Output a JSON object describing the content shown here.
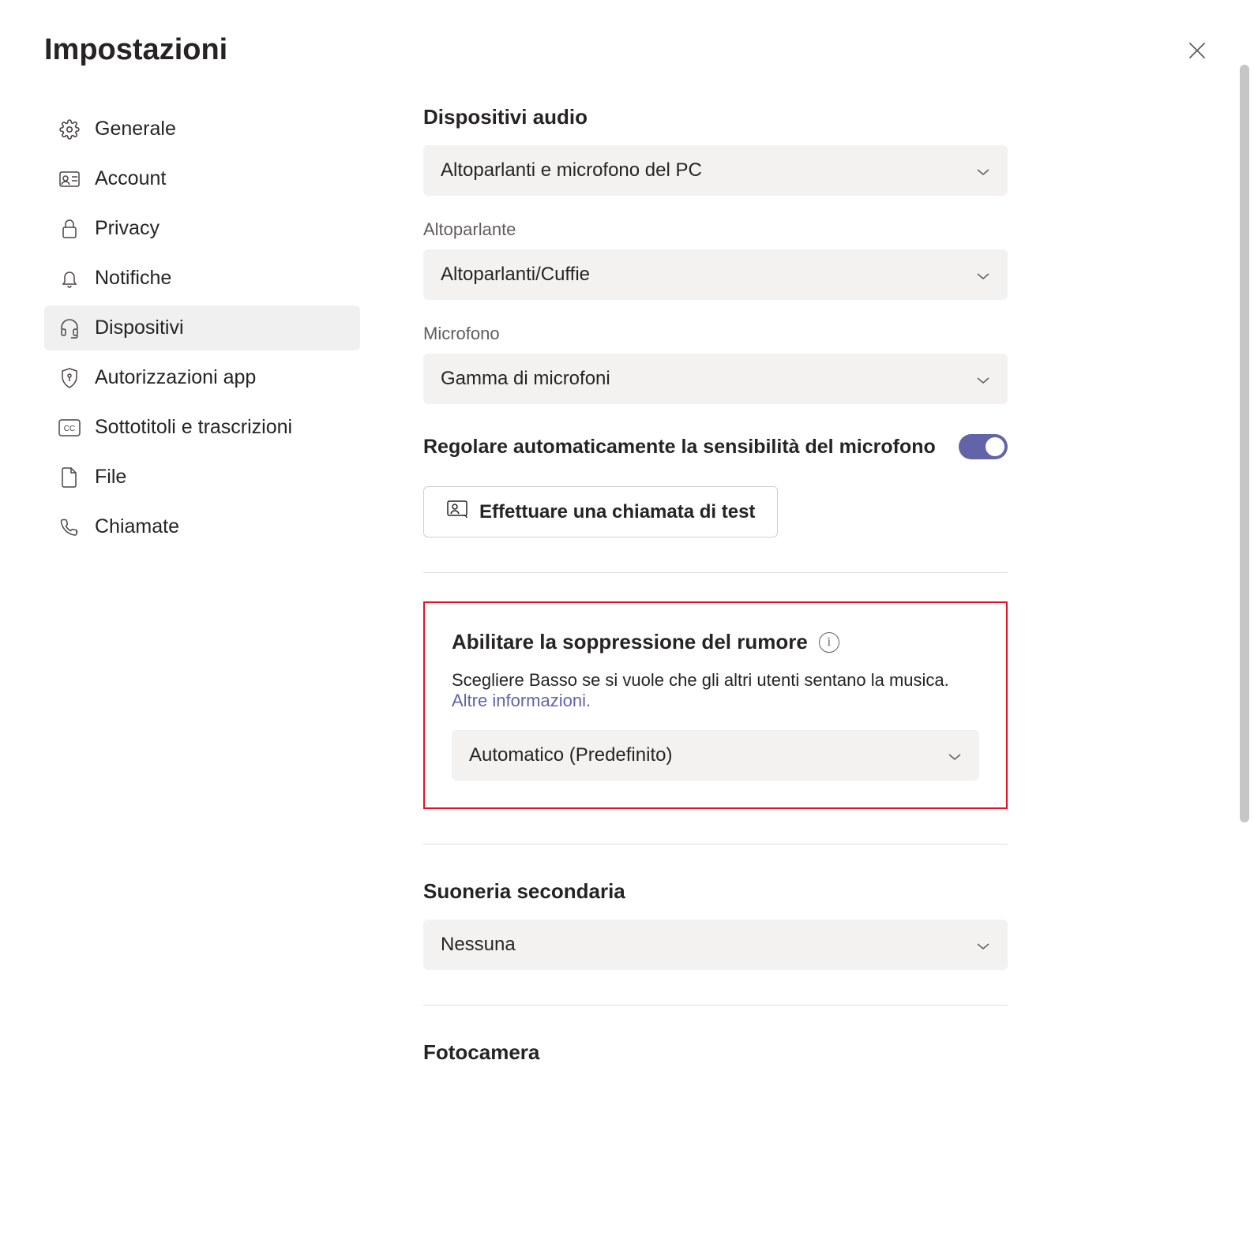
{
  "header": {
    "title": "Impostazioni"
  },
  "sidebar": {
    "items": [
      {
        "label": "Generale"
      },
      {
        "label": "Account"
      },
      {
        "label": "Privacy"
      },
      {
        "label": "Notifiche"
      },
      {
        "label": "Dispositivi"
      },
      {
        "label": "Autorizzazioni app"
      },
      {
        "label": "Sottotitoli e trascrizioni"
      },
      {
        "label": "File"
      },
      {
        "label": "Chiamate"
      }
    ]
  },
  "main": {
    "audio_devices": {
      "title": "Dispositivi audio",
      "value": "Altoparlanti e microfono del PC"
    },
    "speaker": {
      "label": "Altoparlante",
      "value": "Altoparlanti/Cuffie"
    },
    "microphone": {
      "label": "Microfono",
      "value": "Gamma di microfoni"
    },
    "auto_adjust": {
      "label": "Regolare automaticamente la sensibilità del microfono"
    },
    "test_call": {
      "label": "Effettuare una chiamata di test"
    },
    "noise": {
      "title": "Abilitare la soppressione del rumore",
      "desc": "Scegliere Basso se si vuole che gli altri utenti sentano la musica.",
      "more": "Altre informazioni.",
      "value": "Automatico (Predefinito)"
    },
    "ringer": {
      "title": "Suoneria secondaria",
      "value": "Nessuna"
    },
    "camera": {
      "title": "Fotocamera"
    }
  }
}
